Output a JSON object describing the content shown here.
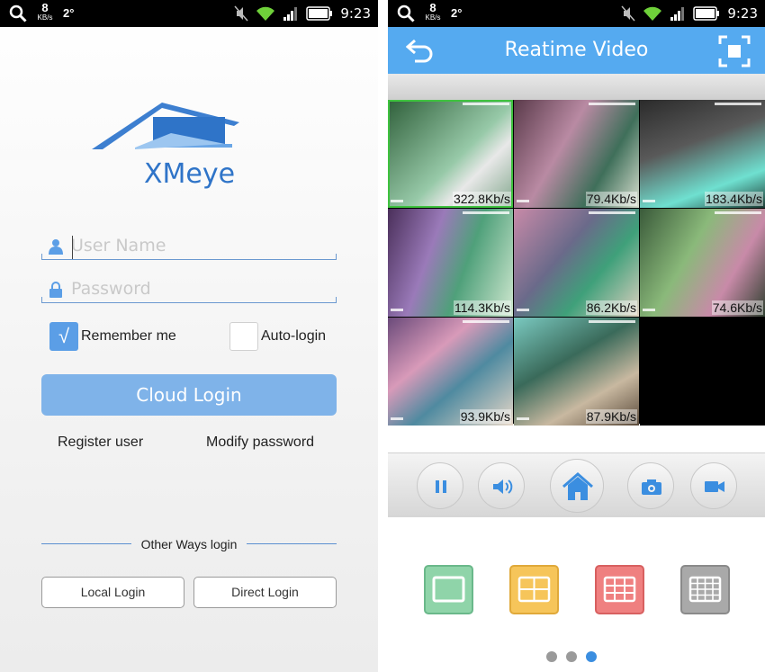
{
  "status_bar": {
    "speed_value": "8",
    "speed_unit": "KB/s",
    "degree": "2°",
    "time": "9:23"
  },
  "login": {
    "brand": "XMeye",
    "username_placeholder": "User Name",
    "password_placeholder": "Password",
    "remember_label": "Remember me",
    "remember_checked": true,
    "autologin_label": "Auto-login",
    "autologin_checked": false,
    "cloud_login": "Cloud Login",
    "register_user": "Register user",
    "modify_password": "Modify password",
    "other_ways": "Other Ways login",
    "local_login": "Local Login",
    "direct_login": "Direct Login"
  },
  "video": {
    "title": "Reatime Video",
    "channels": [
      {
        "rate": "322.8Kb/s",
        "selected": true
      },
      {
        "rate": "79.4Kb/s"
      },
      {
        "rate": "183.4Kb/s"
      },
      {
        "rate": "114.3Kb/s"
      },
      {
        "rate": "86.2Kb/s"
      },
      {
        "rate": "74.6Kb/s"
      },
      {
        "rate": "93.9Kb/s"
      },
      {
        "rate": "87.9Kb/s"
      }
    ],
    "controls": [
      "pause-icon",
      "volume-icon",
      "home-icon",
      "camera-icon",
      "video-record-icon"
    ],
    "layouts": [
      {
        "name": "1-split",
        "color": "#8fd4a9"
      },
      {
        "name": "4-split",
        "color": "#f6c55a"
      },
      {
        "name": "9-split",
        "color": "#ef8080"
      },
      {
        "name": "16-split",
        "color": "#a9a9a9"
      }
    ],
    "page_index": 3,
    "page_count": 3
  },
  "colors": {
    "accent": "#55aaf0",
    "button": "#7fb3e9",
    "brand": "#2f74c8"
  }
}
